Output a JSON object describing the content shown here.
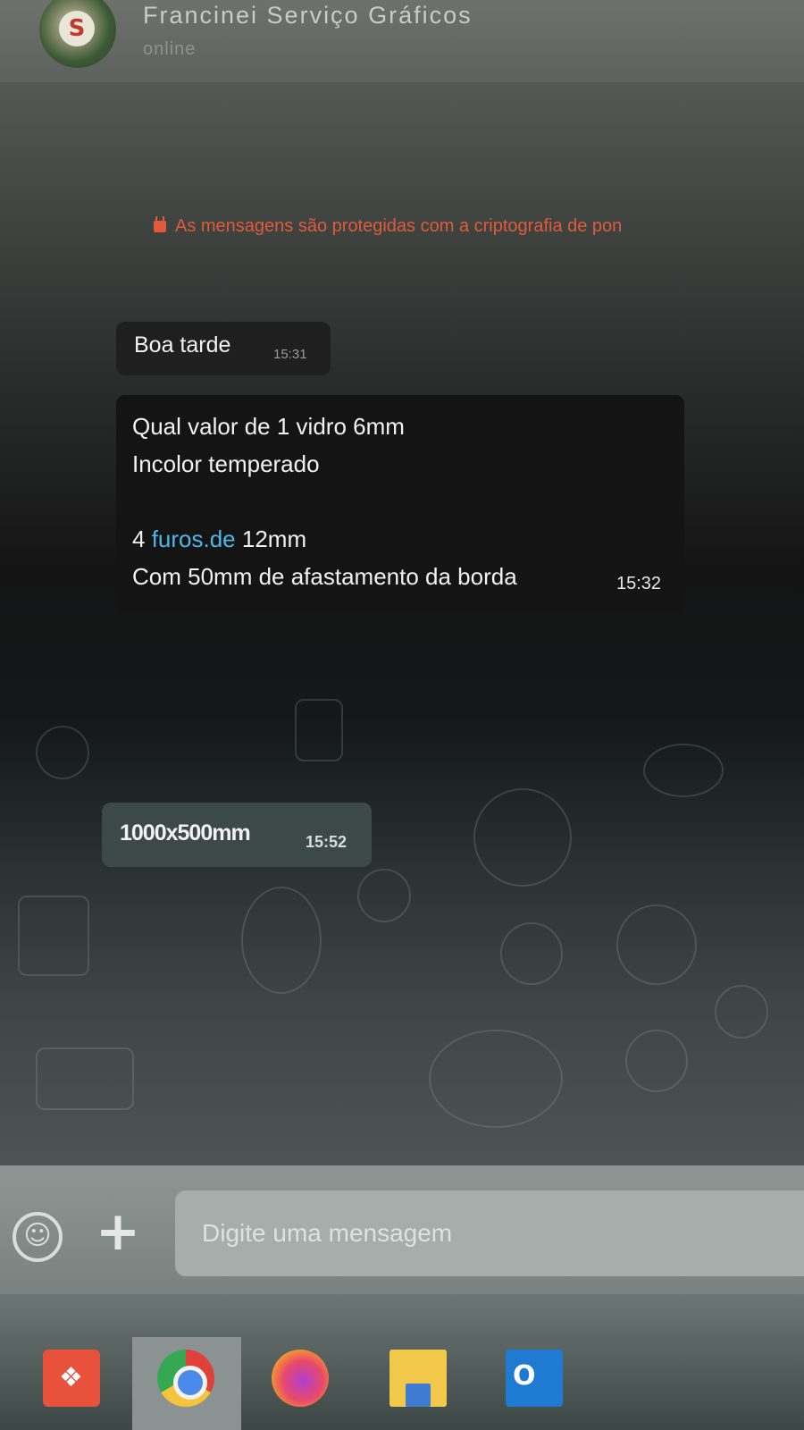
{
  "header": {
    "contact_name": "Francinei Serviço Gráficos",
    "status": "online",
    "avatar_letter": "S"
  },
  "chat": {
    "encryption_notice": "As mensagens são protegidas com a criptografia de pon",
    "messages": [
      {
        "lines": [
          "Boa tarde"
        ],
        "time": "15:31"
      },
      {
        "lines": [
          "Qual valor de 1 vidro 6mm",
          "Incolor temperado",
          "",
          "4 ",
          "Com 50mm de afastamento da borda"
        ],
        "link_line_prefix": "4 ",
        "link_text": "furos.de",
        "link_line_suffix": " 12mm",
        "time": "15:32"
      },
      {
        "lines": [
          "1000x500mm"
        ],
        "time": "15:52"
      }
    ]
  },
  "composer": {
    "emoji_icon": "emoji-icon",
    "attach_icon": "plus-icon",
    "placeholder": "Digite uma mensagem"
  },
  "taskbar": {
    "apps": [
      "AnyDesk",
      "Chrome",
      "Firefox",
      "File Explorer",
      "Outlook"
    ],
    "anydesk_glyph": "❖",
    "outlook_glyph": "O"
  },
  "colors": {
    "encryption_text": "#e05a3c",
    "link": "#4fb6e8",
    "sent_bubble": "#3d4949",
    "received_bubble": "#141414"
  }
}
